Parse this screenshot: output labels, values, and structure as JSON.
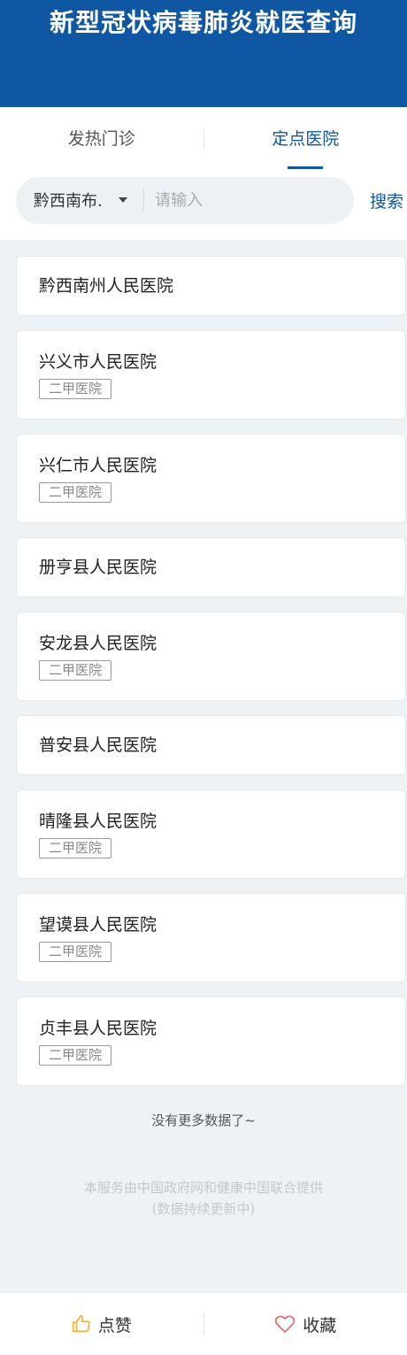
{
  "header": {
    "title": "新型冠状病毒肺炎就医查询"
  },
  "tabs": [
    {
      "label": "发热门诊",
      "active": false
    },
    {
      "label": "定点医院",
      "active": true
    }
  ],
  "search": {
    "region": "黔西南布...",
    "placeholder": "请输入",
    "value": "",
    "button_label": "搜索"
  },
  "hospitals": [
    {
      "name": "黔西南州人民医院",
      "badge": ""
    },
    {
      "name": "兴义市人民医院",
      "badge": "二甲医院"
    },
    {
      "name": "兴仁市人民医院",
      "badge": "二甲医院"
    },
    {
      "name": "册亨县人民医院",
      "badge": ""
    },
    {
      "name": "安龙县人民医院",
      "badge": "二甲医院"
    },
    {
      "name": "普安县人民医院",
      "badge": ""
    },
    {
      "name": "晴隆县人民医院",
      "badge": "二甲医院"
    },
    {
      "name": "望谟县人民医院",
      "badge": "二甲医院"
    },
    {
      "name": "贞丰县人民医院",
      "badge": "二甲医院"
    }
  ],
  "list_end_text": "没有更多数据了~",
  "footer": {
    "line1": "本服务由中国政府网和健康中国联合提供",
    "line2": "(数据持续更新中)"
  },
  "bottom_bar": {
    "like_label": "点赞",
    "like_icon": "thumbs-up-icon",
    "favorite_label": "收藏",
    "favorite_icon": "heart-icon"
  },
  "colors": {
    "brand": "#0f56a3",
    "like_icon": "#f0b13a",
    "favorite_icon": "#e0706f"
  }
}
